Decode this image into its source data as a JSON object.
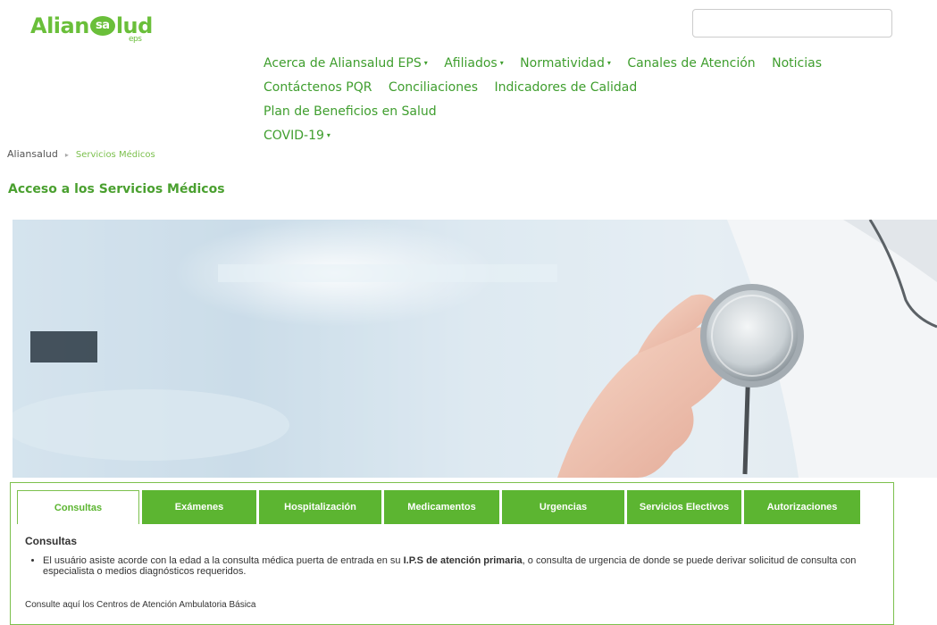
{
  "logo": {
    "text_a": "Alian",
    "text_b": "sa",
    "text_c": "lud",
    "sub": "eps"
  },
  "search": {
    "placeholder": "",
    "value": ""
  },
  "nav": {
    "items": [
      {
        "label": "Acerca de Aliansalud EPS",
        "dropdown": true
      },
      {
        "label": "Afiliados",
        "dropdown": true
      },
      {
        "label": "Normatividad",
        "dropdown": true
      },
      {
        "label": "Canales de Atención",
        "dropdown": false
      },
      {
        "label": "Noticias",
        "dropdown": false
      },
      {
        "label": "Contáctenos PQR",
        "dropdown": false
      },
      {
        "label": "Conciliaciones",
        "dropdown": false
      },
      {
        "label": "Indicadores de Calidad",
        "dropdown": false
      },
      {
        "label": "Plan de Beneficios en Salud",
        "dropdown": false
      },
      {
        "label": "COVID-19",
        "dropdown": true
      }
    ],
    "caret": "▾"
  },
  "breadcrumb": {
    "home": "Aliansalud",
    "separator": "▸",
    "current": "Servicios Médicos"
  },
  "page_title": "Acceso a los Servicios Médicos",
  "tabs": [
    {
      "label": "Consultas",
      "active": true
    },
    {
      "label": "Exámenes",
      "active": false
    },
    {
      "label": "Hospitalización",
      "active": false
    },
    {
      "label": "Medicamentos",
      "active": false
    },
    {
      "label": "Urgencias",
      "active": false
    },
    {
      "label": "Servicios Electivos",
      "active": false
    },
    {
      "label": "Autorizaciones",
      "active": false
    }
  ],
  "content": {
    "heading": "Consultas",
    "bullet_pre": "El usuário asiste acorde con la edad a la consulta médica puerta de entrada en su ",
    "bullet_bold": "I.P.S de atención primaria",
    "bullet_post": ", o consulta de urgencia de donde se puede derivar solicitud de consulta con especialista o medios diagnósticos requeridos.",
    "footer": "Consulte aquí los Centros de Atención Ambulatoria Básica"
  },
  "colors": {
    "brand_green": "#5cb531",
    "link_green": "#3f9e2e"
  },
  "hero": {
    "image": "doctor hand holding stethoscope over blurred hospital background"
  }
}
